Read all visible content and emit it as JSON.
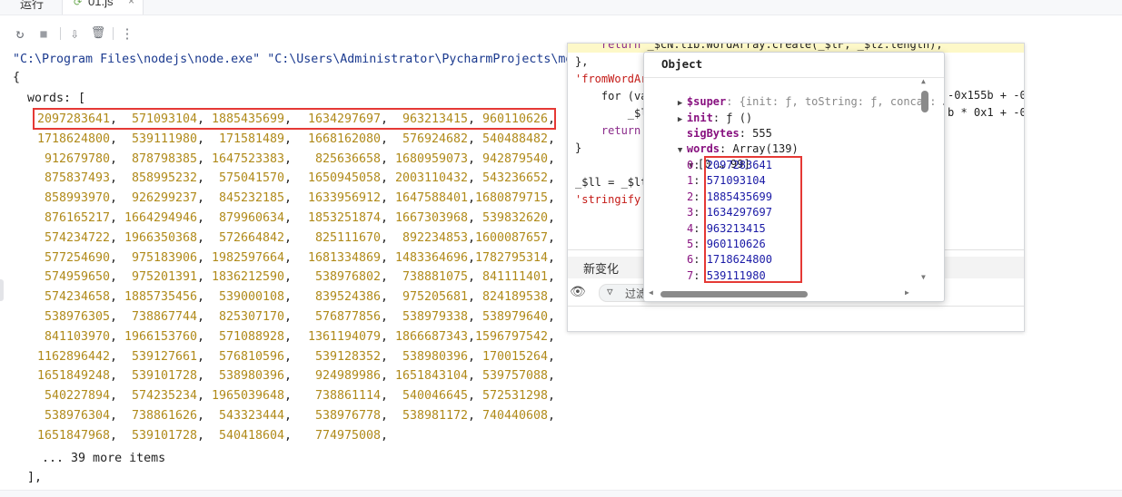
{
  "tabs": {
    "run_label": "运行",
    "file_tab_label": "01.js",
    "file_tab_close": "×"
  },
  "toolbar": {
    "rerun_icon": "↻",
    "stop_icon": "■",
    "scroll_end_icon": "⇩",
    "clear_icon": "🗑",
    "more_icon": "⋮"
  },
  "console": {
    "command": "\"C:\\Program Files\\nodejs\\node.exe\" \"C:\\Users\\Administrator\\PycharmProjects\\mo",
    "open_brace": "{",
    "words_key": "  words: [",
    "rows": [
      [
        "2097283641",
        "571093104",
        "1885435699",
        "1634297697",
        "963213415",
        "960110626"
      ],
      [
        "1718624800",
        "539111980",
        "171581489",
        "1668162080",
        "576924682",
        "540488482"
      ],
      [
        "912679780",
        "878798385",
        "1647523383",
        "825636658",
        "1680959073",
        "942879540"
      ],
      [
        "875837493",
        "858995232",
        "575041570",
        "1650945058",
        "2003110432",
        "543236652"
      ],
      [
        "858993970",
        "926299237",
        "845232185",
        "1633956912",
        "1647588401",
        "1680879715"
      ],
      [
        "876165217",
        "1664294946",
        "879960634",
        "1853251874",
        "1667303968",
        "539832620"
      ],
      [
        "574234722",
        "1966350368",
        "572664842",
        "825111670",
        "892234853",
        "1600087657"
      ],
      [
        "577254690",
        "975183906",
        "1982597664",
        "1681334869",
        "1483364696",
        "1782795314"
      ],
      [
        "574959650",
        "975201391",
        "1836212590",
        "538976802",
        "738881075",
        "841111401"
      ],
      [
        "574234658",
        "1885735456",
        "539000108",
        "839524386",
        "975205681",
        "824189538"
      ],
      [
        "538976305",
        "738867744",
        "825307170",
        "576877856",
        "538979338",
        "538979640"
      ],
      [
        "841103970",
        "1966153760",
        "571088928",
        "1361194079",
        "1866687343",
        "1596797542"
      ],
      [
        "1162896442",
        "539127661",
        "576810596",
        "539128352",
        "538980396",
        "170015264"
      ],
      [
        "1651849248",
        "539101728",
        "538980396",
        "924989986",
        "1651843104",
        "539757088"
      ],
      [
        "540227894",
        "574235234",
        "1965039648",
        "738861114",
        "540046645",
        "572531298"
      ],
      [
        "538976304",
        "738861626",
        "543323444",
        "538976778",
        "538981172",
        "740440608"
      ],
      [
        "1651847968",
        "539101728",
        "540418604",
        "774975008"
      ]
    ],
    "more_items": "    ... 39 more items",
    "close_bracket": "  ],"
  },
  "devtools": {
    "code_lines": [
      {
        "parts": [
          {
            "c": "kw",
            "t": "    return "
          },
          {
            "c": "plain",
            "t": "_$cN.lib.WordArray.create(_$lF, _$lz.length);"
          }
        ]
      },
      {
        "parts": [
          {
            "c": "plain",
            "t": "},"
          }
        ]
      },
      {
        "parts": [
          {
            "c": "str",
            "t": "'fromWordArr"
          }
        ]
      },
      {
        "parts": [
          {
            "c": "plain",
            "t": "    for (va"
          }
        ]
      },
      {
        "parts": [
          {
            "c": "plain",
            "t": "        _$l"
          }
        ]
      },
      {
        "parts": [
          {
            "c": "kw",
            "t": "    return"
          }
        ]
      },
      {
        "parts": [
          {
            "c": "plain",
            "t": "}"
          }
        ]
      },
      {
        "parts": [
          {
            "c": "plain",
            "t": ""
          }
        ]
      },
      {
        "parts": [
          {
            "c": "plain",
            "t": "_$ll = _$lt"
          }
        ]
      },
      {
        "parts": [
          {
            "c": "str",
            "t": "'stringify'"
          }
        ]
      }
    ],
    "right_code_1": "-0x155b + -0x",
    "right_code_2": "b * 0x1 + -0x",
    "changes_tab": "新变化",
    "filter_label": "过滤"
  },
  "popup": {
    "title": "Object",
    "super_key": "$super",
    "super_val": ": {init: ƒ, toString: ƒ, concat: …",
    "init_key": "init",
    "init_val": ": ƒ ()",
    "sigbytes_key": "sigBytes",
    "sigbytes_val": ": 555",
    "words_key": "words",
    "words_val": ": Array(139)",
    "range_label": "[0 … 99]",
    "items": [
      {
        "i": "0",
        "v": "2097283641"
      },
      {
        "i": "1",
        "v": "571093104"
      },
      {
        "i": "2",
        "v": "1885435699"
      },
      {
        "i": "3",
        "v": "1634297697"
      },
      {
        "i": "4",
        "v": "963213415"
      },
      {
        "i": "5",
        "v": "960110626"
      },
      {
        "i": "6",
        "v": "1718624800"
      },
      {
        "i": "7",
        "v": "539111980"
      }
    ]
  },
  "colors": {
    "number": "#b08a1a",
    "highlight_box": "#e53935",
    "command": "#1b3a8f"
  }
}
